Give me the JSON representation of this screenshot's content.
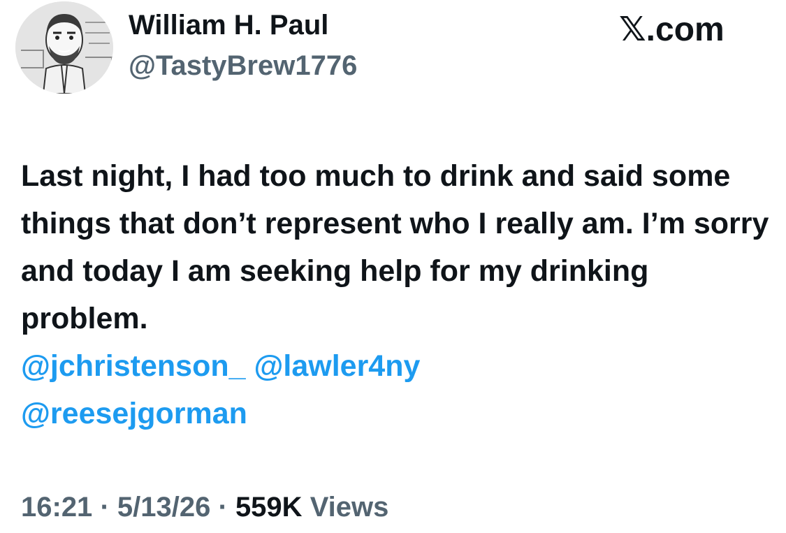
{
  "author": {
    "display_name": "William H. Paul",
    "handle": "@TastyBrew1776",
    "avatar_icon": "cartoon-portrait-avatar"
  },
  "brand": {
    "label": "𝕏.com",
    "icon": "x-logo-icon"
  },
  "tweet": {
    "text": "Last night, I had too much to drink and said some things that don’t represent who I really am. I’m sorry and today I am seeking help for my drinking problem.",
    "mentions": [
      "@jchristenson_",
      "@lawler4ny",
      "@reesejgorman"
    ]
  },
  "meta": {
    "time": "16:21",
    "separator": "·",
    "date": "5/13/26",
    "views_count": "559K",
    "views_label": "Views"
  },
  "colors": {
    "text": "#0f1419",
    "secondary": "#536471",
    "link": "#1d9bf0",
    "background": "#ffffff"
  }
}
